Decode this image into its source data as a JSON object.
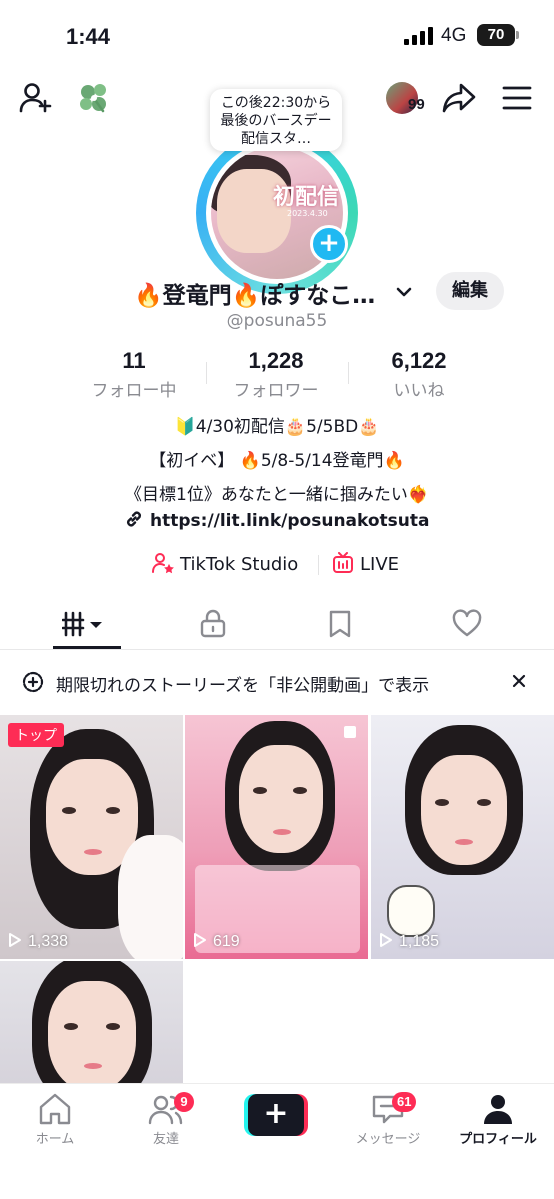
{
  "status_bar": {
    "time": "1:44",
    "network": "4G",
    "battery": "70"
  },
  "header": {
    "visitors_count": "99"
  },
  "avatar": {
    "bubble_text": "この後22:30から最後のバースデー配信スタ…",
    "photo_caption": "初配信",
    "photo_date": "2023.4.30"
  },
  "profile": {
    "name": "🔥登竜門🔥ぽすなこ…",
    "edit_label": "編集",
    "handle": "@posuna55"
  },
  "stats": [
    {
      "value": "11",
      "label": "フォロー中"
    },
    {
      "value": "1,228",
      "label": "フォロワー"
    },
    {
      "value": "6,122",
      "label": "いいね"
    }
  ],
  "bio": {
    "line1": "🔰4/30初配信🎂5/5BD🎂",
    "line2": "【初イベ】 🔥5/8-5/14登竜門🔥",
    "line3": "《目標1位》あなたと一緒に掴みたい❤️‍🔥",
    "link": "https://lit.link/posunakotsuta"
  },
  "shortcuts": {
    "studio": "TikTok Studio",
    "live": "LIVE"
  },
  "notice": {
    "text": "期限切れのストーリーズを「非公開動画」で表示"
  },
  "videos": [
    {
      "views": "1,338",
      "badge": "トップ"
    },
    {
      "views": "619"
    },
    {
      "views": "1,185"
    },
    {
      "views": ""
    }
  ],
  "bottom_nav": [
    {
      "label": "ホーム"
    },
    {
      "label": "友達",
      "badge": "9"
    },
    {
      "label": ""
    },
    {
      "label": "メッセージ",
      "badge": "61"
    },
    {
      "label": "プロフィール"
    }
  ],
  "colors": {
    "accent": "#fe2c55",
    "ring": "#38d0f0",
    "plus": "#20b9f2"
  }
}
